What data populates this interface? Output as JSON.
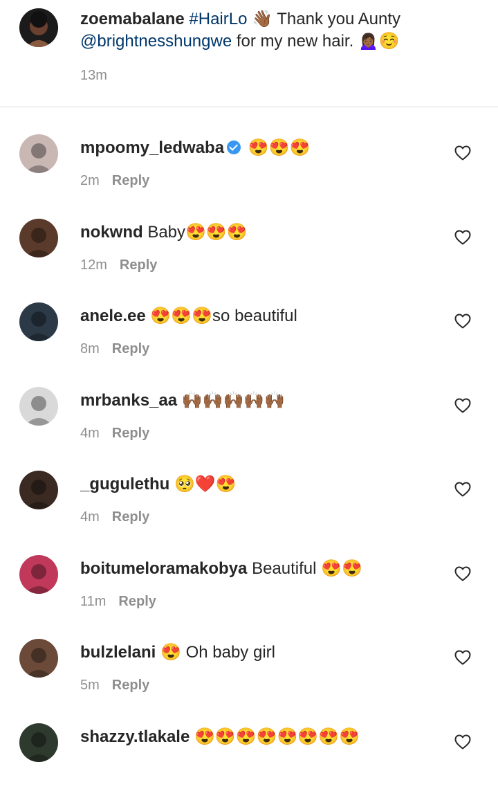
{
  "caption": {
    "username": "zoemabalane",
    "hashtag": "#HairLo",
    "emoji_1": "👋🏾",
    "text_1": " Thank you Aunty",
    "mention": "@brightnesshungwe",
    "text_2": " for my new hair. ",
    "emoji_2": "🙍🏾‍♀️☺️",
    "time": "13m"
  },
  "comments": [
    {
      "username": "mpoomy_ledwaba",
      "verified": true,
      "text": "😍😍😍",
      "time": "2m",
      "reply": "Reply",
      "avatar_color": "#c9b7b4"
    },
    {
      "username": "nokwnd",
      "text": "Baby😍😍😍",
      "time": "12m",
      "reply": "Reply",
      "avatar_color": "#5a3a2a"
    },
    {
      "username": "anele.ee",
      "text": "😍😍😍so beautiful",
      "time": "8m",
      "reply": "Reply",
      "avatar_color": "#2c3a48"
    },
    {
      "username": "mrbanks_aa",
      "text": "🙌🏾🙌🏾🙌🏾🙌🏾🙌🏾",
      "time": "4m",
      "reply": "Reply",
      "avatar_color": "#d9d9d9"
    },
    {
      "username": "_gugulethu",
      "text": "🥺❤️😍",
      "time": "4m",
      "reply": "Reply",
      "avatar_color": "#3a2a22"
    },
    {
      "username": "boitumeloramakobya",
      "text": "Beautiful 😍😍",
      "time": "11m",
      "reply": "Reply",
      "avatar_color": "#c0395a"
    },
    {
      "username": "bulzlelani",
      "text": "😍 Oh baby girl",
      "time": "5m",
      "reply": "Reply",
      "avatar_color": "#6b4a3a"
    },
    {
      "username": "shazzy.tlakale",
      "text": "😍😍😍😍😍😍😍😍",
      "time": "",
      "reply": "",
      "avatar_color": "#2f3a2e"
    }
  ]
}
